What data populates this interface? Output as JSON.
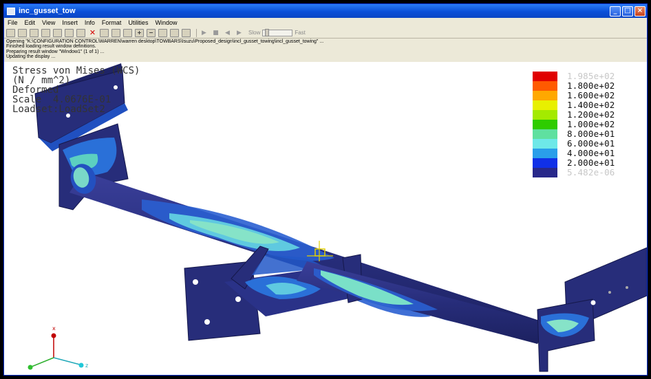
{
  "window": {
    "title": "inc_gusset_tow"
  },
  "menu": {
    "items": [
      "File",
      "Edit",
      "View",
      "Insert",
      "Info",
      "Format",
      "Utilities",
      "Window"
    ]
  },
  "toolbar": {
    "slow_label": "Slow",
    "fast_label": "Fast"
  },
  "messages": [
    "Opening \"K:\\CONFIGURATION CONTROL\\WARREN\\warren desktop\\TOWBARS\\Isuzu\\Proposed_design\\incl_gusset_towing\\incl_gusset_towing\" ...",
    "Finished loading result window definitions.",
    "Preparing result window \"Window1\" (1 of 1) ...",
    "Updating the display ..."
  ],
  "plot_info": {
    "line1": "Stress von Mises (WCS)",
    "line2": "(N / mm^2)",
    "line3": "Deformed",
    "line4": "Scale  4.0676E-01",
    "line5": "Loadset:LoadSet2"
  },
  "legend": [
    {
      "label": "1.985e+02",
      "color": "#e00000",
      "faint": true
    },
    {
      "label": "1.800e+02",
      "color": "#ff5a00"
    },
    {
      "label": "1.600e+02",
      "color": "#ffa800"
    },
    {
      "label": "1.400e+02",
      "color": "#e8f000"
    },
    {
      "label": "1.200e+02",
      "color": "#a4ea00"
    },
    {
      "label": "1.000e+02",
      "color": "#2ecc00"
    },
    {
      "label": "8.000e+01",
      "color": "#5fe0a0"
    },
    {
      "label": "6.000e+01",
      "color": "#6ee8e8"
    },
    {
      "label": "4.000e+01",
      "color": "#2a9eea"
    },
    {
      "label": "2.000e+01",
      "color": "#1030e8"
    },
    {
      "label": "5.482e-06",
      "color": "#28288a",
      "faint": true
    }
  ],
  "axes": {
    "x": "x",
    "z": "z"
  },
  "colors": {
    "model": "#272d7a",
    "model_dark": "#1c2160",
    "high_stress": "#7be0d0"
  }
}
